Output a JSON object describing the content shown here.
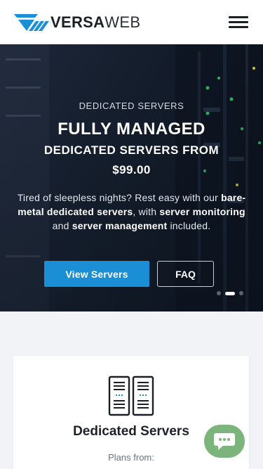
{
  "header": {
    "brand_bold": "VERSA",
    "brand_light": "WEB",
    "menu_icon": "hamburger-menu-icon"
  },
  "hero": {
    "eyebrow": "DEDICATED SERVERS",
    "title_line1": "FULLY MANAGED",
    "title_line2": "DEDICATED SERVERS FROM",
    "price": "$99.00",
    "desc_1": "Tired of sleepless nights? Rest easy with our ",
    "desc_bold_1": "bare-metal dedicated servers",
    "desc_2": ", with ",
    "desc_bold_2": "server monitoring",
    "desc_3": " and ",
    "desc_bold_3": "server management",
    "desc_4": " included.",
    "primary_button": "View Servers",
    "secondary_button": "FAQ",
    "slides": 3,
    "active_slide": 2
  },
  "card": {
    "icon": "server-rack-icon",
    "title": "Dedicated Servers",
    "subtitle": "Plans from:"
  },
  "chat": {
    "icon": "chat-bubble-icon"
  },
  "colors": {
    "accent": "#1a8fd6",
    "chat": "#7bb57b",
    "dark": "#1b1f27"
  }
}
